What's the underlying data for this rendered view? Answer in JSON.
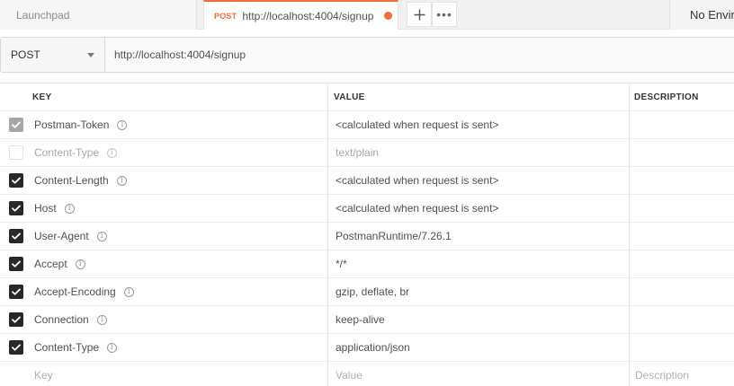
{
  "tabs": {
    "launchpad_label": "Launchpad",
    "active": {
      "method": "POST",
      "url": "http://localhost:4004/signup",
      "unsaved": true
    },
    "add_icon": "plus-icon",
    "more_icon": "ellipsis-icon",
    "more_label": "•••"
  },
  "environment": {
    "selected": "No Environment"
  },
  "request": {
    "method": "POST",
    "url": "http://localhost:4004/signup"
  },
  "headers_table": {
    "columns": {
      "key": "KEY",
      "value": "VALUE",
      "description": "DESCRIPTION"
    },
    "rows": [
      {
        "key": "Postman-Token",
        "value": "<calculated when request is sent>",
        "checked": true,
        "locked": true,
        "muted": false
      },
      {
        "key": "Content-Type",
        "value": "text/plain",
        "checked": false,
        "locked": false,
        "muted": true
      },
      {
        "key": "Content-Length",
        "value": "<calculated when request is sent>",
        "checked": true,
        "locked": false,
        "muted": false
      },
      {
        "key": "Host",
        "value": "<calculated when request is sent>",
        "checked": true,
        "locked": false,
        "muted": false
      },
      {
        "key": "User-Agent",
        "value": "PostmanRuntime/7.26.1",
        "checked": true,
        "locked": false,
        "muted": false
      },
      {
        "key": "Accept",
        "value": "*/*",
        "checked": true,
        "locked": false,
        "muted": false
      },
      {
        "key": "Accept-Encoding",
        "value": "gzip, deflate, br",
        "checked": true,
        "locked": false,
        "muted": false
      },
      {
        "key": "Connection",
        "value": "keep-alive",
        "checked": true,
        "locked": false,
        "muted": false
      },
      {
        "key": "Content-Type",
        "value": "application/json",
        "checked": true,
        "locked": false,
        "muted": false
      }
    ],
    "new_row": {
      "key_placeholder": "Key",
      "value_placeholder": "Value",
      "description_placeholder": "Description"
    }
  },
  "info_icon_glyph": "i",
  "colors": {
    "accent": "#f26b3a",
    "checkbox_on": "#282828",
    "checkbox_locked": "#a6a6a6"
  }
}
